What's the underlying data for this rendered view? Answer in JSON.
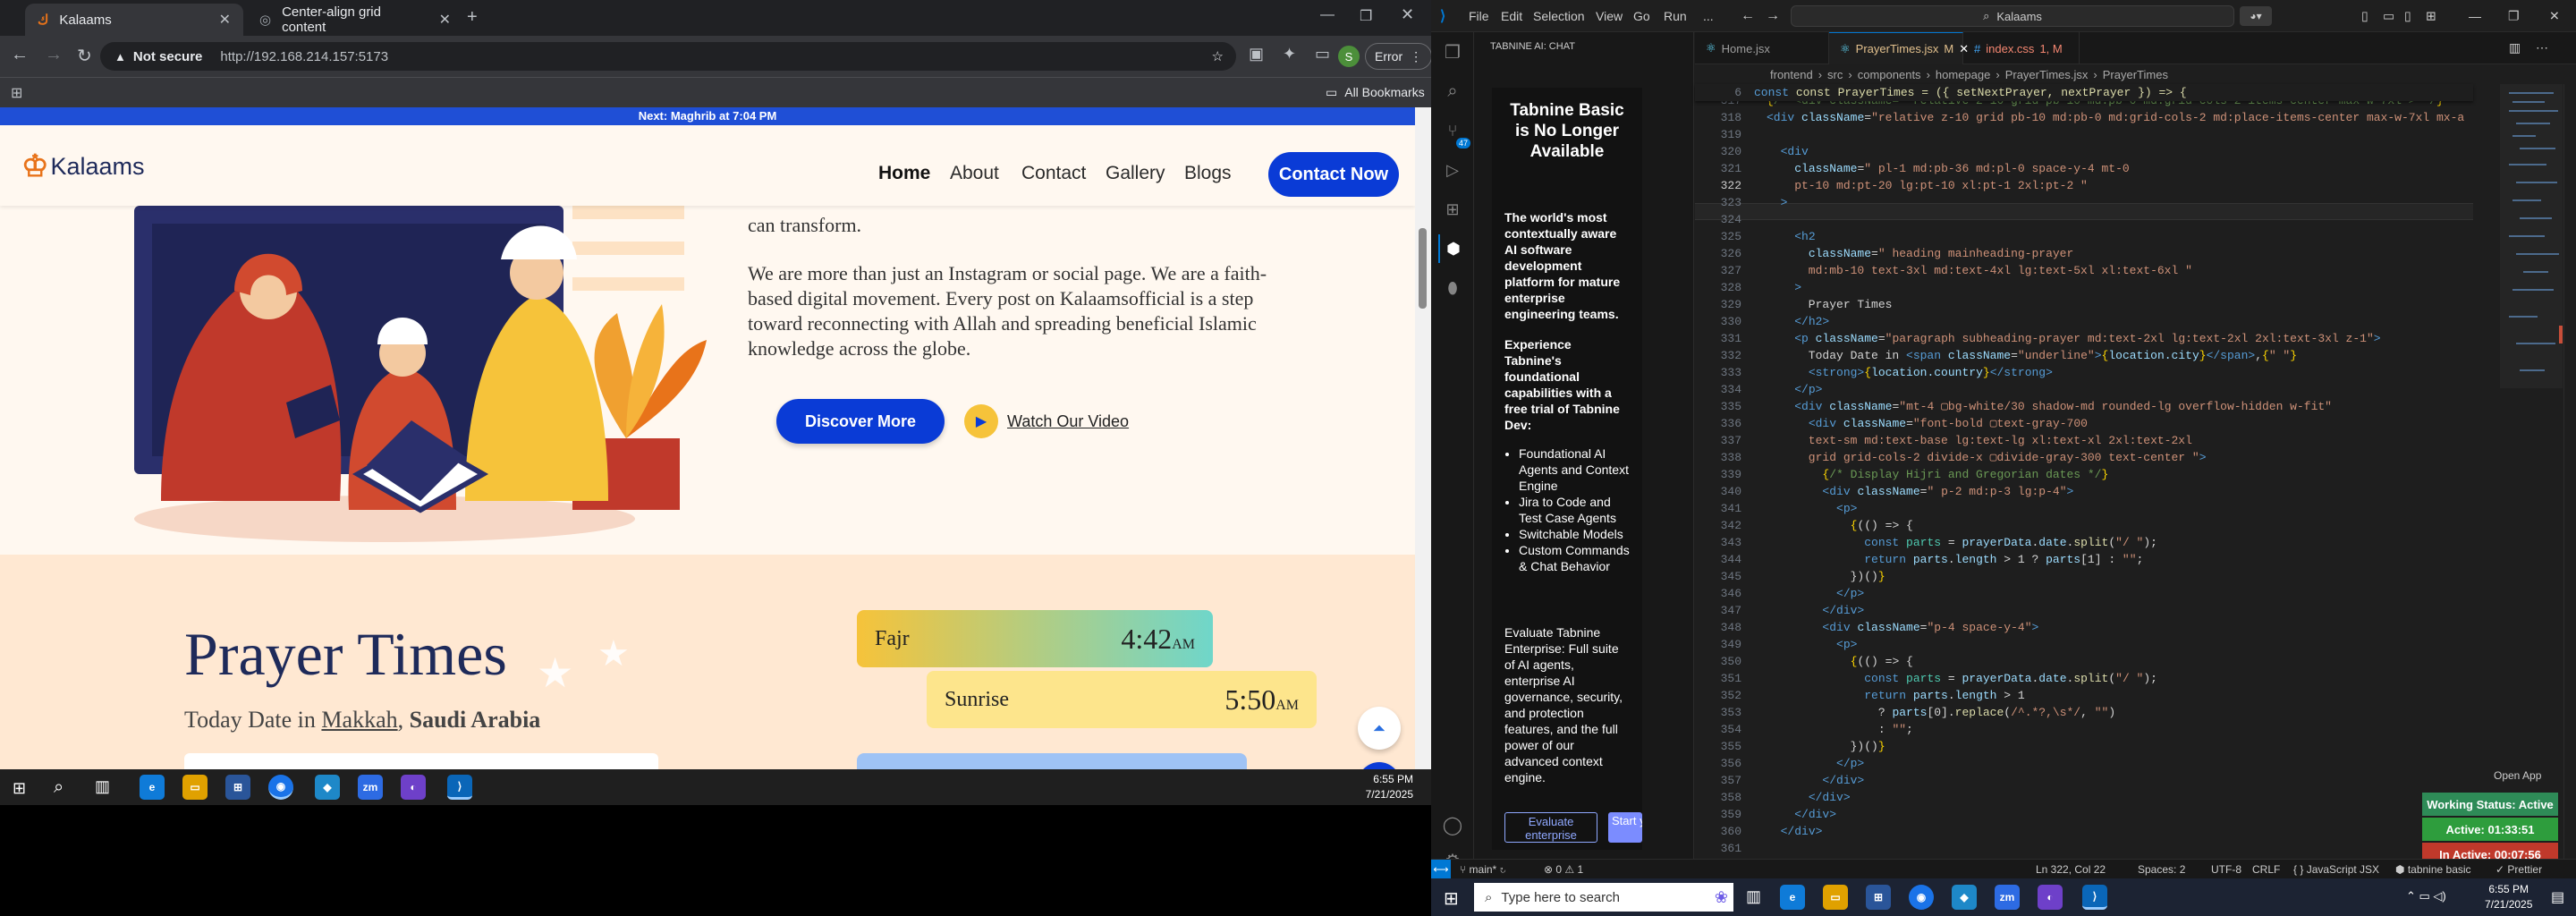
{
  "browser": {
    "tabs": [
      {
        "title": "Kalaams",
        "active": true
      },
      {
        "title": "Center-align grid content",
        "active": false
      }
    ],
    "new_tab": "+",
    "not_secure": "Not secure",
    "url": "http://192.168.214.157:5173",
    "avatar_letter": "S",
    "error_label": "Error",
    "all_bookmarks": "All Bookmarks"
  },
  "site": {
    "notice": "Next: Maghrib at 7:04 PM",
    "logo_text": "Kalaams",
    "nav": [
      "Home",
      "About",
      "Contact",
      "Gallery",
      "Blogs"
    ],
    "cta": "Contact Now",
    "para_top": "can transform.",
    "para_main": "We are more than just an Instagram or social page. We are a faith-based digital movement. Every post on Kalaamsofficial is a step toward reconnecting with Allah and spreading beneficial Islamic knowledge across the globe.",
    "discover": "Discover More",
    "watch": "Watch Our Video",
    "prayer_title": "Prayer Times",
    "today_prefix": "Today Date in",
    "city": "Makkah",
    "country": "Saudi Arabia",
    "prayers": [
      {
        "name": "Fajr",
        "time": "4:42",
        "ampm": "AM"
      },
      {
        "name": "Sunrise",
        "time": "5:50",
        "ampm": "AM"
      }
    ]
  },
  "taskbar_left": {
    "time": "6:55 PM",
    "date": "7/21/2025"
  },
  "vscode": {
    "menu": [
      "File",
      "Edit",
      "Selection",
      "View",
      "Go",
      "Run",
      "..."
    ],
    "command_center": "Kalaams",
    "sidebar_title": "TABNINE AI: CHAT",
    "tabnine": {
      "heading": "Tabnine Basic is No Longer Available",
      "intro": "The world's most contextually aware AI software development platform for mature enterprise engineering teams.",
      "experience": "Experience Tabnine's foundational capabilities with a free trial of Tabnine Dev:",
      "bullets": [
        "Foundational AI Agents and Context Engine",
        "Jira to Code and Test Case Agents",
        "Switchable Models",
        "Custom Commands & Chat Behavior"
      ],
      "evaluate": "Evaluate Tabnine Enterprise: Full suite of AI agents, enterprise AI governance, security, and protection features, and the full power of our advanced context engine.",
      "btn_eval": "Evaluate enterprise",
      "btn_start": "Start your Dev trial"
    },
    "tabs": [
      {
        "name": "Home.jsx",
        "active": false,
        "mark": ""
      },
      {
        "name": "PrayerTimes.jsx",
        "active": true,
        "mark": "M"
      },
      {
        "name": "index.css",
        "active": false,
        "mark": "1, M"
      }
    ],
    "breadcrumb": [
      "frontend",
      "src",
      "components",
      "homepage",
      "PrayerTimes.jsx",
      "PrayerTimes"
    ],
    "sticky_line_no": "6",
    "sticky_line": "const PrayerTimes = ({ setNextPrayer, nextPrayer }) => {",
    "first_line": 317,
    "current_line": 322,
    "status": {
      "branch": "main*",
      "errors": "0",
      "warnings": "1",
      "position": "Ln 322, Col 22",
      "spaces": "Spaces: 2",
      "encoding": "UTF-8",
      "eol": "CRLF",
      "language": "JavaScript JSX",
      "tabnine": "tabnine basic",
      "prettier": "Prettier"
    },
    "open_app": "Open App",
    "working": {
      "status": "Working Status: Active",
      "active": "Active: 01:33:51",
      "inactive": "In Active: 00:07:56"
    }
  },
  "taskbar_right": {
    "search": "Type here to search",
    "time": "6:55 PM",
    "date": "7/21/2025"
  },
  "colors": {
    "brand_blue": "#0a3bd6",
    "logo_orange": "#e8731a",
    "title_navy": "#1e2a5a",
    "vs_accent": "#0078d4"
  }
}
